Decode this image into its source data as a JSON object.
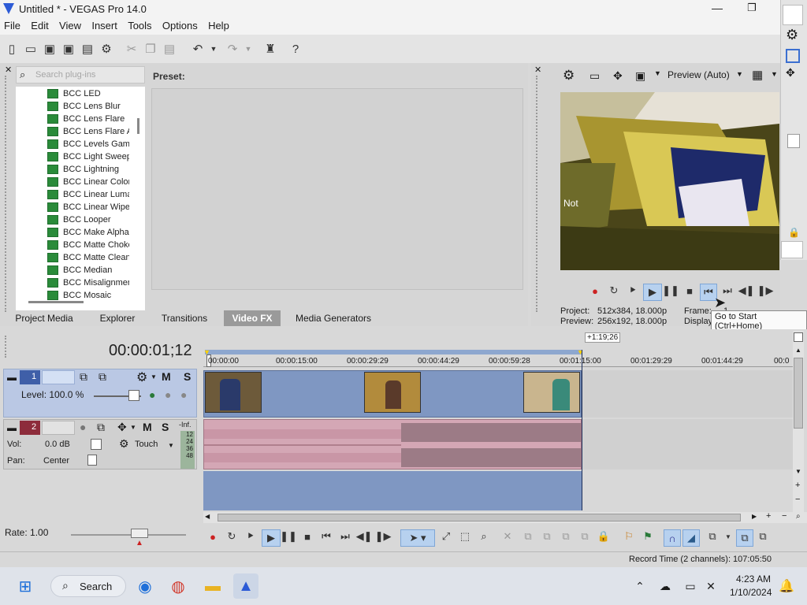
{
  "window": {
    "title": "Untitled * - VEGAS Pro 14.0",
    "app_icon": "vegas-logo"
  },
  "menu": [
    "File",
    "Edit",
    "View",
    "Insert",
    "Tools",
    "Options",
    "Help"
  ],
  "plugins": {
    "search_placeholder": "Search plug-ins",
    "preset_label": "Preset:",
    "items": [
      "BCC LED",
      "BCC Lens Blur",
      "BCC Lens Flare",
      "BCC Lens Flare Ac",
      "BCC Levels Gamm",
      "BCC Light Sweep",
      "BCC Lightning",
      "BCC Linear Color K",
      "BCC Linear Luma K",
      "BCC Linear Wipe",
      "BCC Looper",
      "BCC Make Alpha K",
      "BCC Matte Choker",
      "BCC Matte Cleanu",
      "BCC Median",
      "BCC Misalignment",
      "BCC Mosaic"
    ]
  },
  "tabs": [
    "Project Media",
    "Explorer",
    "Transitions",
    "Video FX",
    "Media Generators"
  ],
  "active_tab": "Video FX",
  "preview": {
    "mode_label": "Preview (Auto)",
    "project_label": "Project:",
    "project_value": "512x384, 18.000p",
    "preview_label": "Preview:",
    "preview_value": "256x192, 18.000p",
    "frame_label": "Frame:",
    "frame_value": "1",
    "display_label": "Display:",
    "overlay_text": "Not",
    "tooltip": "Go to Start (Ctrl+Home)"
  },
  "timeline": {
    "timecode": "00:00:01;12",
    "region_duration": "+1:19;26",
    "ruler": [
      "00:00:00",
      "00:00:15:00",
      "00:00:29:29",
      "00:00:44:29",
      "00:00:59:28",
      "00:01:15:00",
      "00:01:29:29",
      "00:01:44:29",
      "00:0"
    ],
    "video_track": {
      "number": "1",
      "level_label": "Level: 100.0 %",
      "mute": "M",
      "solo": "S",
      "level_percent": 100
    },
    "audio_track": {
      "number": "2",
      "vol_label": "Vol:",
      "vol_value": "0.0 dB",
      "pan_label": "Pan:",
      "pan_value": "Center",
      "touch_label": "Touch",
      "mute": "M",
      "solo": "S",
      "meter_labels": [
        "-Inf.",
        "12",
        "24",
        "36",
        "48"
      ]
    },
    "rate_label": "Rate: 1.00"
  },
  "status": {
    "record_time": "Record Time (2 channels): 107:05:50"
  },
  "taskbar": {
    "search": "Search",
    "time": "4:23 AM",
    "date": "1/10/2024"
  },
  "colors": {
    "track_blue": "#7f97c2",
    "audio_pink": "#d4a7b5",
    "accent": "#3b6fd1"
  }
}
